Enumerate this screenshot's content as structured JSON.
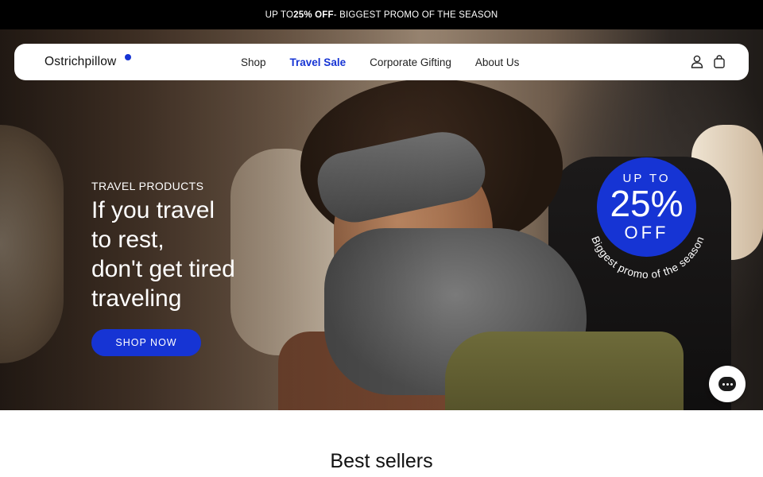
{
  "promo_bar": {
    "prefix": "UP TO ",
    "highlight": "25% OFF",
    "suffix": " - BIGGEST PROMO OF THE SEASON"
  },
  "nav": {
    "logo": "Ostrichpillow",
    "links": [
      {
        "label": "Shop",
        "active": false
      },
      {
        "label": "Travel Sale",
        "active": true
      },
      {
        "label": "Corporate Gifting",
        "active": false
      },
      {
        "label": "About Us",
        "active": false
      }
    ],
    "icons": [
      "user-icon",
      "bag-icon"
    ]
  },
  "hero": {
    "eyebrow": "TRAVEL PRODUCTS",
    "headline_lines": [
      "If you travel",
      "to rest,",
      "don't get tired",
      "traveling"
    ],
    "cta_label": "SHOP NOW"
  },
  "badge": {
    "top": "UP TO",
    "percent": "25%",
    "bottom": "OFF",
    "arc_text": "Biggest promo of the season"
  },
  "section": {
    "title": "Best sellers"
  },
  "colors": {
    "accent": "#1634d4",
    "promo_bg": "#000000"
  },
  "chat": {
    "icon": "chat-icon"
  }
}
